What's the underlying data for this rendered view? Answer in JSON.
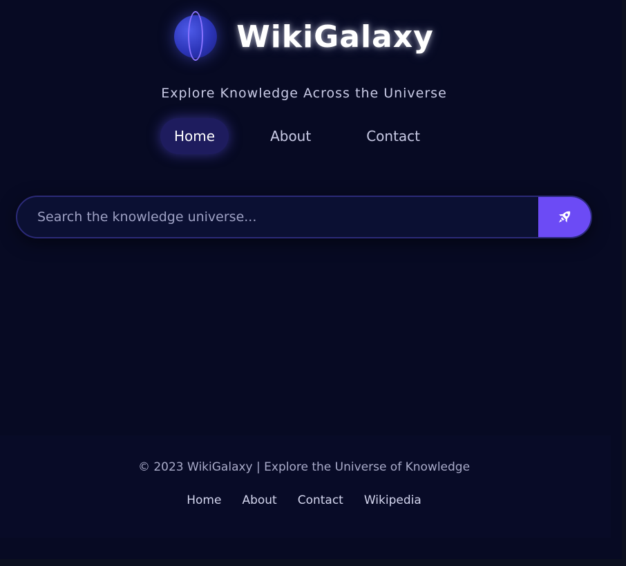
{
  "brand": {
    "name": "WikiGalaxy",
    "tagline": "Explore Knowledge Across the Universe",
    "logo_icon": "planet-icon"
  },
  "nav": {
    "items": [
      {
        "label": "Home",
        "active": true
      },
      {
        "label": "About",
        "active": false
      },
      {
        "label": "Contact",
        "active": false
      }
    ]
  },
  "search": {
    "placeholder": "Search the knowledge universe...",
    "value": "",
    "button_icon": "rocket-icon"
  },
  "footer": {
    "copyright": "© 2023 WikiGalaxy | Explore the Universe of Knowledge",
    "links": [
      "Home",
      "About",
      "Contact",
      "Wikipedia"
    ]
  },
  "colors": {
    "background": "#070a23",
    "accent": "#6c4bf5",
    "nav_active_bg": "#1e1c5e",
    "text": "#c9cbe6"
  }
}
